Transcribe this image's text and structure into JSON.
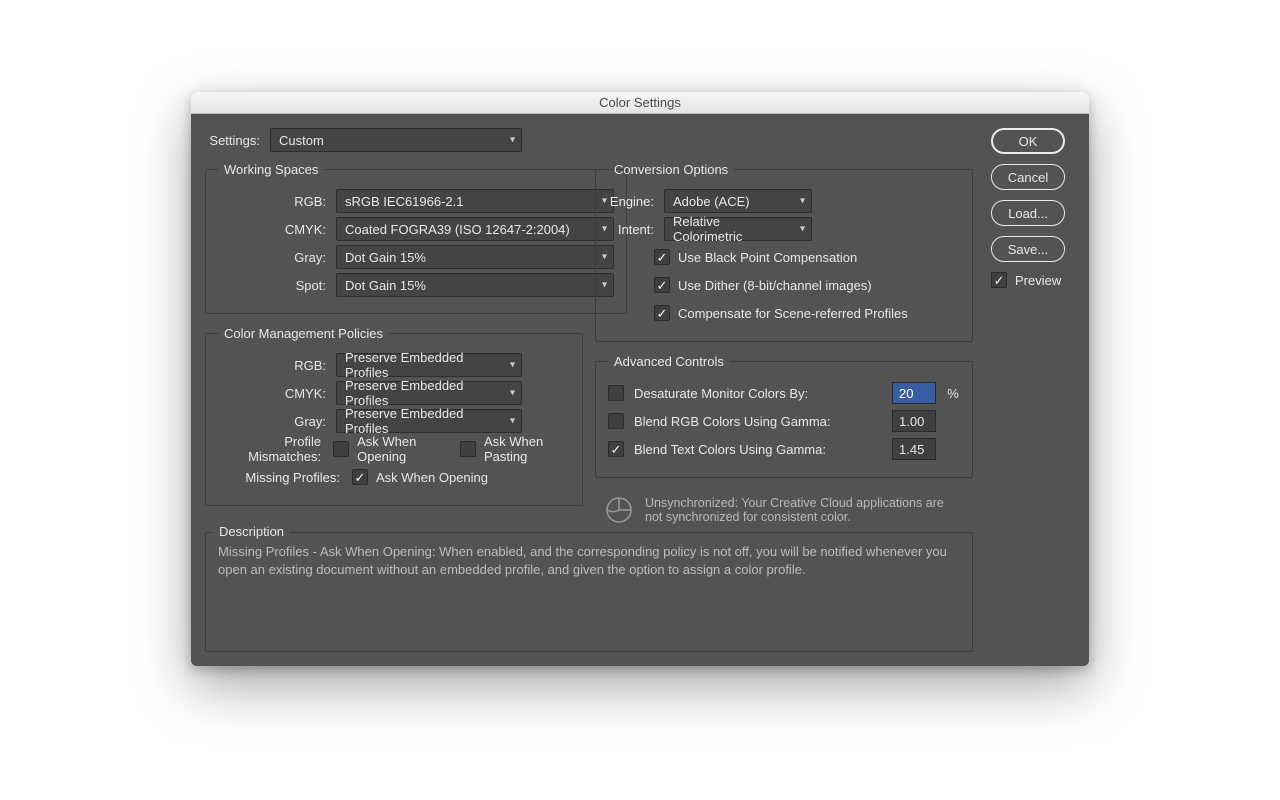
{
  "title": "Color Settings",
  "settings": {
    "label": "Settings:",
    "value": "Custom"
  },
  "buttons": {
    "ok": "OK",
    "cancel": "Cancel",
    "load": "Load...",
    "save": "Save..."
  },
  "preview": {
    "label": "Preview",
    "checked": true
  },
  "working_spaces": {
    "legend": "Working Spaces",
    "rgb": {
      "label": "RGB:",
      "value": "sRGB IEC61966-2.1"
    },
    "cmyk": {
      "label": "CMYK:",
      "value": "Coated FOGRA39 (ISO 12647-2:2004)"
    },
    "gray": {
      "label": "Gray:",
      "value": "Dot Gain 15%"
    },
    "spot": {
      "label": "Spot:",
      "value": "Dot Gain 15%"
    }
  },
  "policies": {
    "legend": "Color Management Policies",
    "rgb": {
      "label": "RGB:",
      "value": "Preserve Embedded Profiles"
    },
    "cmyk": {
      "label": "CMYK:",
      "value": "Preserve Embedded Profiles"
    },
    "gray": {
      "label": "Gray:",
      "value": "Preserve Embedded Profiles"
    },
    "mismatches": {
      "label": "Profile Mismatches:",
      "open": "Ask When Opening",
      "paste": "Ask When Pasting",
      "open_checked": false,
      "paste_checked": false
    },
    "missing": {
      "label": "Missing Profiles:",
      "open": "Ask When Opening",
      "open_checked": true
    }
  },
  "conversion": {
    "legend": "Conversion Options",
    "engine": {
      "label": "Engine:",
      "value": "Adobe (ACE)"
    },
    "intent": {
      "label": "Intent:",
      "value": "Relative Colorimetric"
    },
    "bpc": {
      "label": "Use Black Point Compensation",
      "checked": true
    },
    "dither": {
      "label": "Use Dither (8-bit/channel images)",
      "checked": true
    },
    "scene": {
      "label": "Compensate for Scene-referred Profiles",
      "checked": true
    }
  },
  "advanced": {
    "legend": "Advanced Controls",
    "desat": {
      "label": "Desaturate Monitor Colors By:",
      "value": "20",
      "suffix": "%",
      "checked": false
    },
    "blend_rgb": {
      "label": "Blend RGB Colors Using Gamma:",
      "value": "1.00",
      "checked": false
    },
    "blend_txt": {
      "label": "Blend Text Colors Using Gamma:",
      "value": "1.45",
      "checked": true
    }
  },
  "unsync": "Unsynchronized: Your Creative Cloud applications are not synchronized for consistent color.",
  "description": {
    "legend": "Description",
    "text": "Missing Profiles - Ask When Opening:  When enabled, and the corresponding policy is not off, you will be notified whenever you open an existing document without an embedded profile, and given the option to assign a color profile."
  }
}
